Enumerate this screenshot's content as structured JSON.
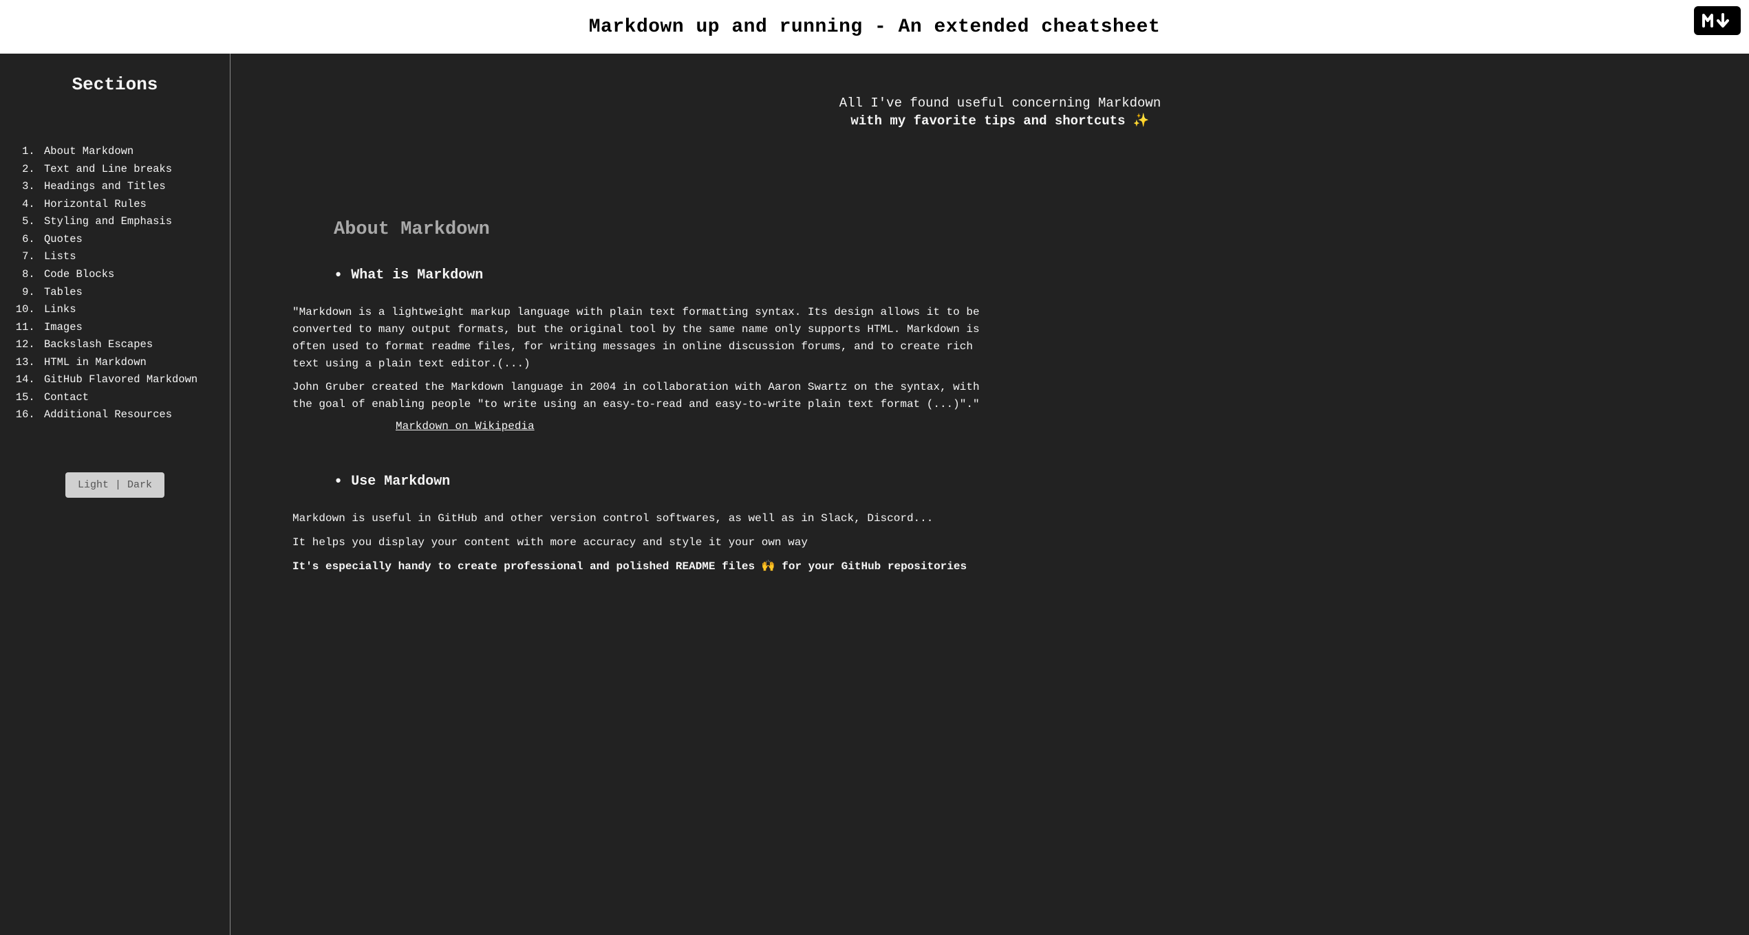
{
  "header": {
    "title": "Markdown up and running - An extended cheatsheet"
  },
  "sidebar": {
    "title": "Sections",
    "items": [
      "About Markdown",
      "Text and Line breaks",
      "Headings and Titles",
      "Horizontal Rules",
      "Styling and Emphasis",
      "Quotes",
      "Lists",
      "Code Blocks",
      "Tables",
      "Links",
      "Images",
      "Backslash Escapes",
      "HTML in Markdown",
      "GitHub Flavored Markdown",
      "Contact",
      "Additional Resources"
    ],
    "theme_button": "Light | Dark"
  },
  "intro": {
    "line1": "All I've found useful concerning Markdown",
    "line2": "with my favorite tips and shortcuts",
    "sparkle": "✨"
  },
  "about": {
    "heading": "About Markdown",
    "sub1": "What is Markdown",
    "para1": "\"Markdown is a lightweight markup language with plain text formatting syntax. Its design allows it to be converted to many output formats, but the original tool by the same name only supports HTML. Markdown is often used to format readme files, for writing messages in online discussion forums, and to create rich text using a plain text editor.(...)",
    "para1b": "John Gruber created the Markdown language in 2004 in collaboration with Aaron Swartz on the syntax, with the goal of enabling people \"to write using an easy-to-read and easy-to-write plain text format (...)\".\"",
    "wiki_label": "Markdown on Wikipedia",
    "sub2": "Use Markdown",
    "para2a": "Markdown is useful in GitHub and other version control softwares, as well as in Slack, Discord...",
    "para2b": "It helps you display your content with more accuracy and style it your own way",
    "para2c_before": "It's especially handy to create professional and polished README files ",
    "para2c_emoji": "🙌",
    "para2c_after": " for your GitHub repositories"
  }
}
